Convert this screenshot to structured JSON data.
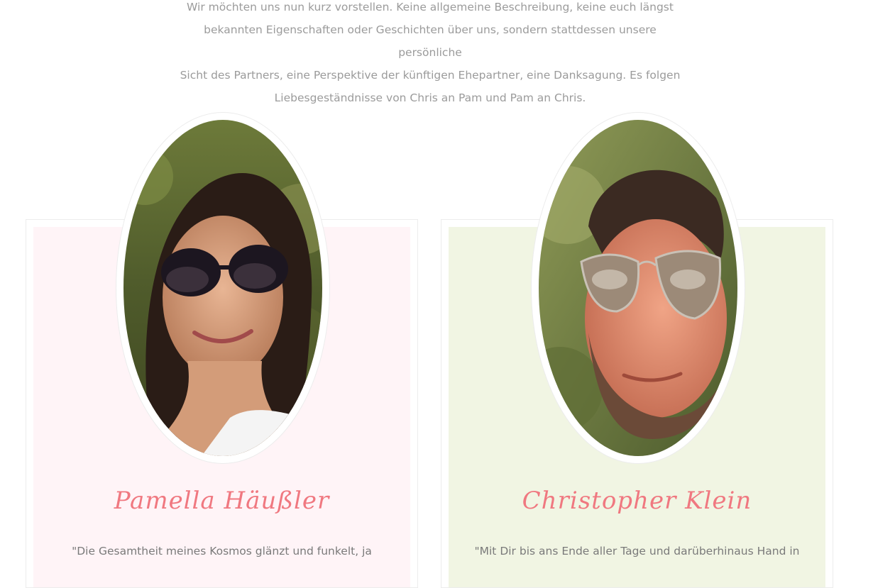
{
  "intro": {
    "line1": "Wir möchten uns nun kurz vorstellen. Keine allgemeine Beschreibung, keine euch längst",
    "line2": "bekannten Eigenschaften oder Geschichten über uns, sondern stattdessen unsere persönliche",
    "line3": "Sicht des Partners, eine Perspektive der künftigen Ehepartner, eine Danksagung. Es folgen",
    "line4": "Liebesgeständnisse von Chris an Pam und Pam an Chris."
  },
  "profiles": [
    {
      "name": "Pamella Häußler",
      "quote": "\"Die Gesamtheit meines Kosmos glänzt und funkelt, ja",
      "photo_icon": "woman-sunglasses-photo"
    },
    {
      "name": "Christopher Klein",
      "quote": "\"Mit Dir bis ans Ende aller Tage und darüberhinaus Hand in",
      "photo_icon": "man-sunglasses-photo"
    }
  ],
  "colors": {
    "name_accent": "#f07880",
    "card_left_bg": "#fff4f7",
    "card_right_bg": "#f1f5e3"
  }
}
